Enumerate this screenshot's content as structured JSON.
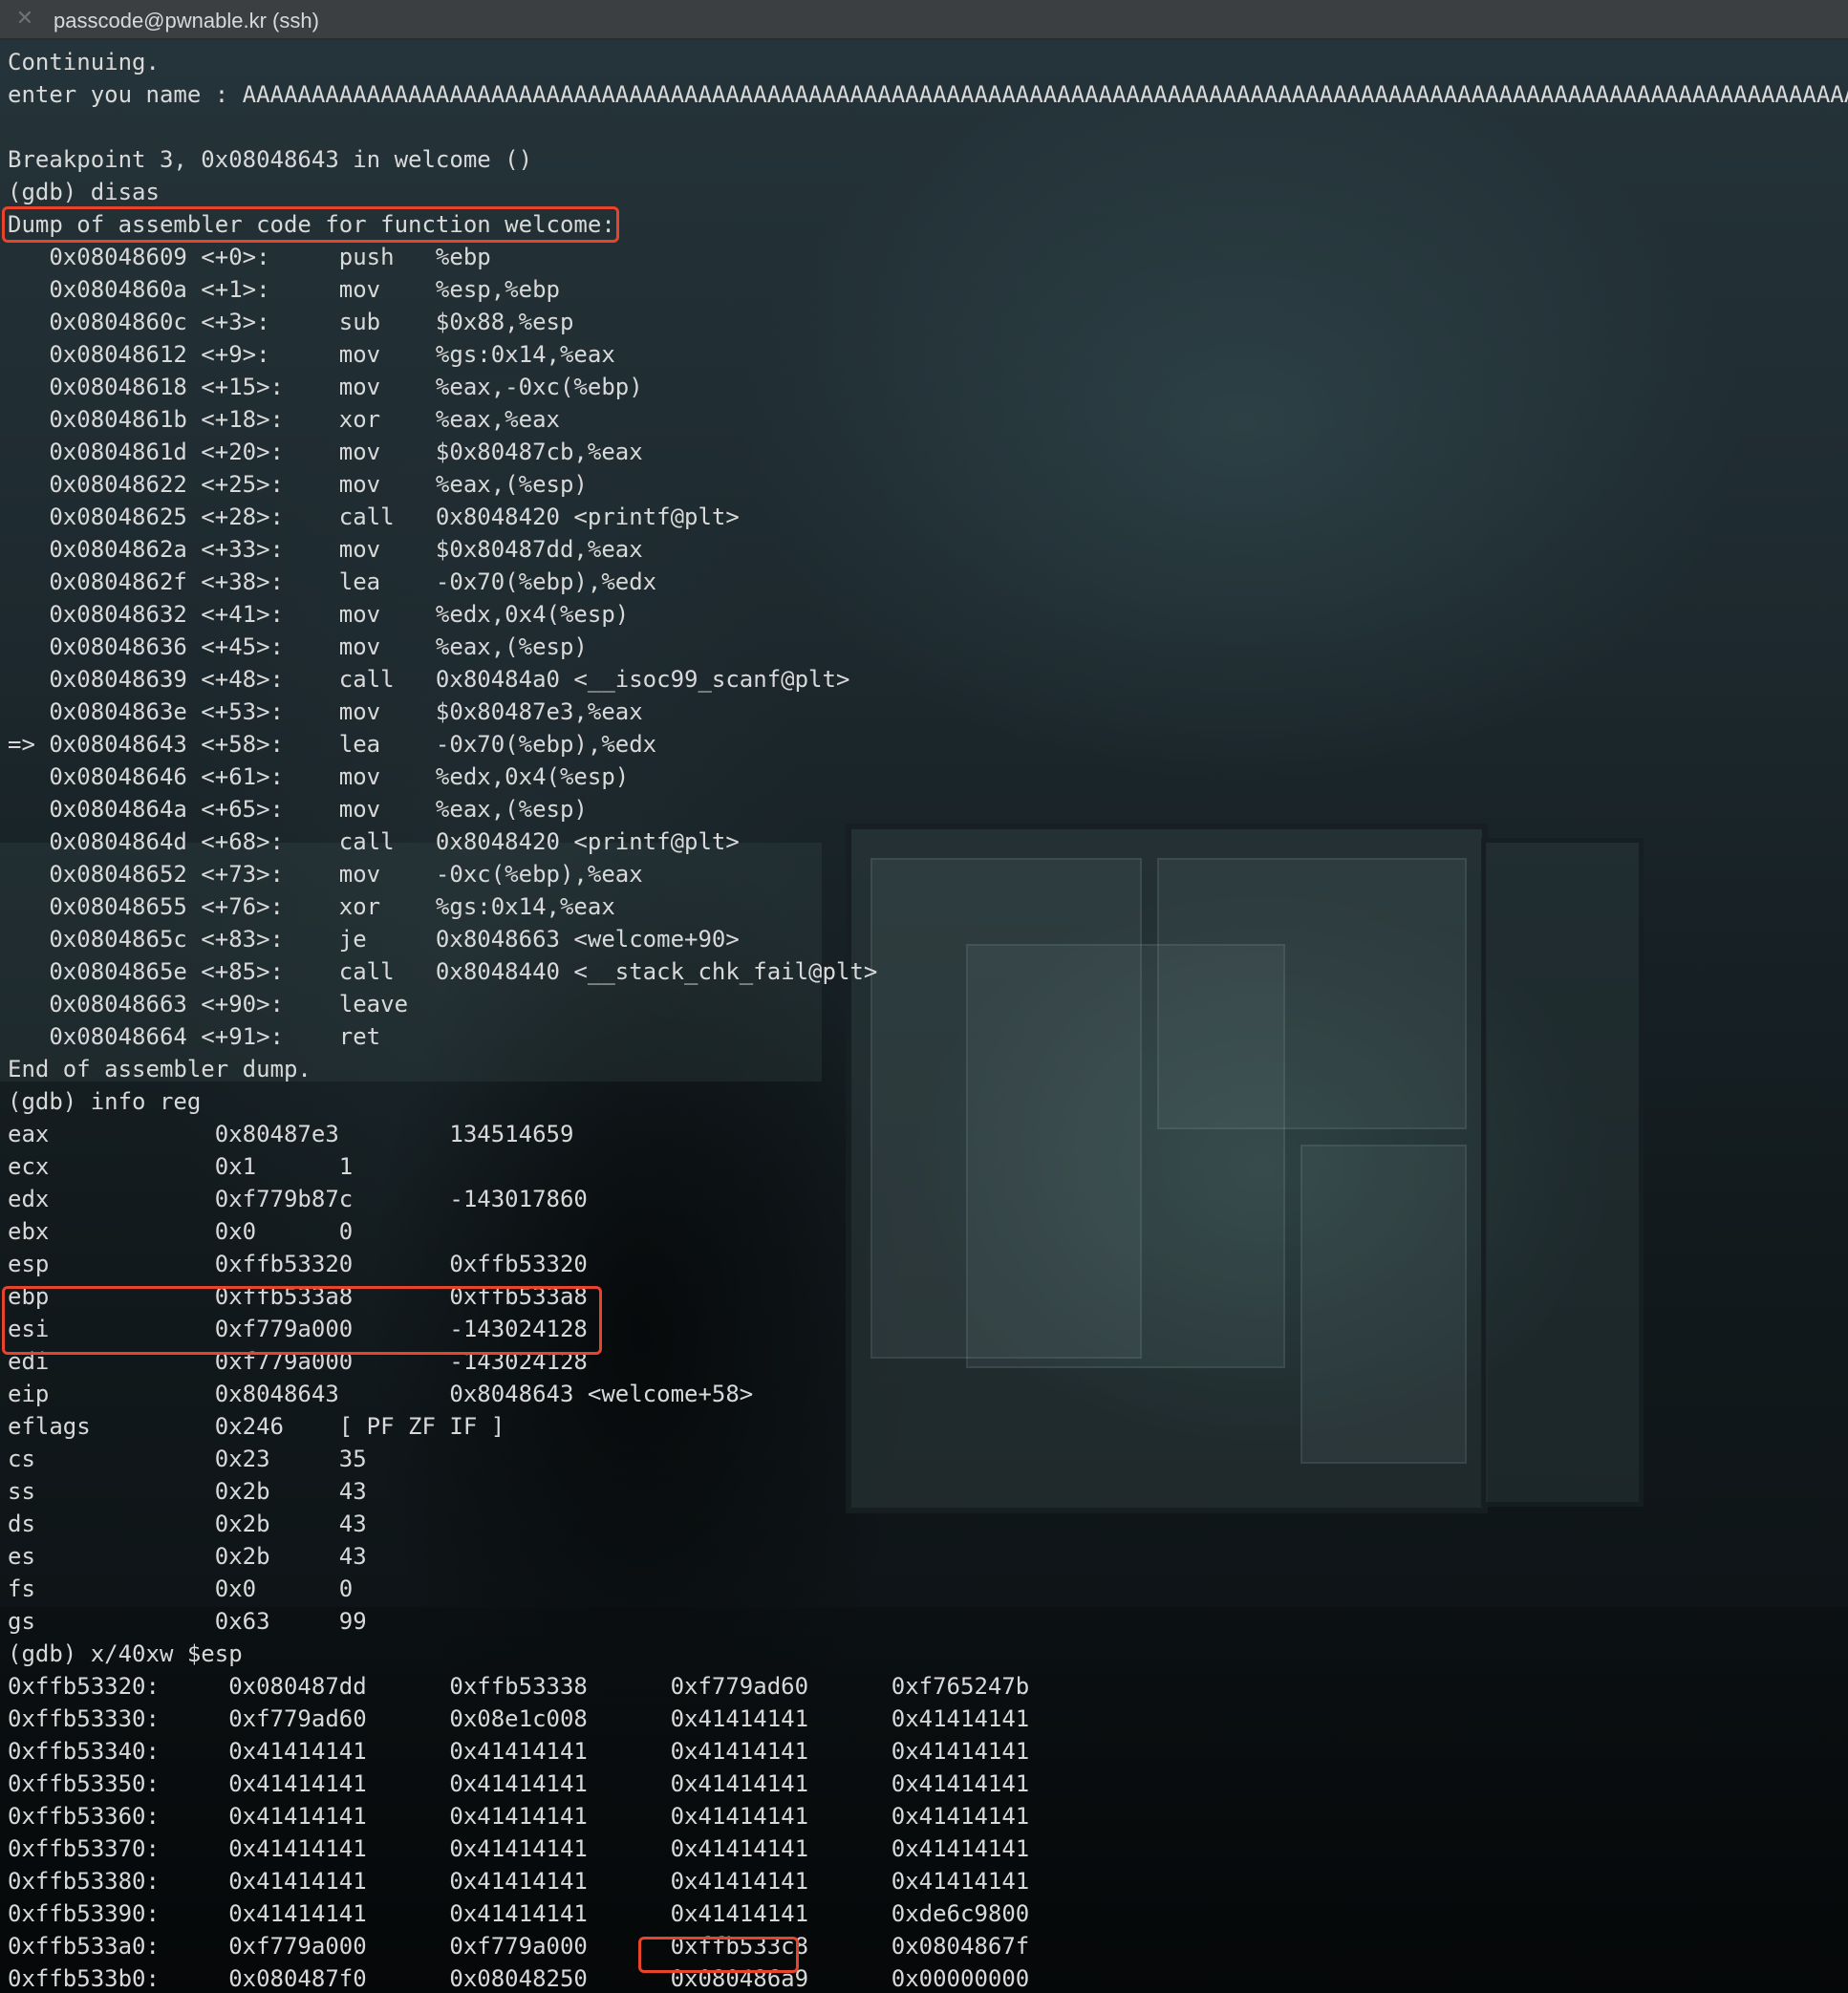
{
  "window": {
    "close_glyph": "✕",
    "title": "passcode@pwnable.kr (ssh)"
  },
  "terminal": {
    "lines": [
      "Continuing.",
      "enter you name : AAAAAAAAAAAAAAAAAAAAAAAAAAAAAAAAAAAAAAAAAAAAAAAAAAAAAAAAAAAAAAAAAAAAAAAAAAAAAAAAAAAAAAAAAAAAAAAAAAAAAAAAAAAAAAAAAAAAAAAA",
      "",
      "Breakpoint 3, 0x08048643 in welcome ()",
      "(gdb) disas",
      "Dump of assembler code for function welcome:",
      "   0x08048609 <+0>:     push   %ebp",
      "   0x0804860a <+1>:     mov    %esp,%ebp",
      "   0x0804860c <+3>:     sub    $0x88,%esp",
      "   0x08048612 <+9>:     mov    %gs:0x14,%eax",
      "   0x08048618 <+15>:    mov    %eax,-0xc(%ebp)",
      "   0x0804861b <+18>:    xor    %eax,%eax",
      "   0x0804861d <+20>:    mov    $0x80487cb,%eax",
      "   0x08048622 <+25>:    mov    %eax,(%esp)",
      "   0x08048625 <+28>:    call   0x8048420 <printf@plt>",
      "   0x0804862a <+33>:    mov    $0x80487dd,%eax",
      "   0x0804862f <+38>:    lea    -0x70(%ebp),%edx",
      "   0x08048632 <+41>:    mov    %edx,0x4(%esp)",
      "   0x08048636 <+45>:    mov    %eax,(%esp)",
      "   0x08048639 <+48>:    call   0x80484a0 <__isoc99_scanf@plt>",
      "   0x0804863e <+53>:    mov    $0x80487e3,%eax",
      "=> 0x08048643 <+58>:    lea    -0x70(%ebp),%edx",
      "   0x08048646 <+61>:    mov    %edx,0x4(%esp)",
      "   0x0804864a <+65>:    mov    %eax,(%esp)",
      "   0x0804864d <+68>:    call   0x8048420 <printf@plt>",
      "   0x08048652 <+73>:    mov    -0xc(%ebp),%eax",
      "   0x08048655 <+76>:    xor    %gs:0x14,%eax",
      "   0x0804865c <+83>:    je     0x8048663 <welcome+90>",
      "   0x0804865e <+85>:    call   0x8048440 <__stack_chk_fail@plt>",
      "   0x08048663 <+90>:    leave",
      "   0x08048664 <+91>:    ret",
      "End of assembler dump.",
      "(gdb) info reg",
      "eax            0x80487e3        134514659",
      "ecx            0x1      1",
      "edx            0xf779b87c       -143017860",
      "ebx            0x0      0",
      "esp            0xffb53320       0xffb53320",
      "ebp            0xffb533a8       0xffb533a8",
      "esi            0xf779a000       -143024128",
      "edi            0xf779a000       -143024128",
      "eip            0x8048643        0x8048643 <welcome+58>",
      "eflags         0x246    [ PF ZF IF ]",
      "cs             0x23     35",
      "ss             0x2b     43",
      "ds             0x2b     43",
      "es             0x2b     43",
      "fs             0x0      0",
      "gs             0x63     99",
      "(gdb) x/40xw $esp",
      "0xffb53320:     0x080487dd      0xffb53338      0xf779ad60      0xf765247b",
      "0xffb53330:     0xf779ad60      0x08e1c008      0x41414141      0x41414141",
      "0xffb53340:     0x41414141      0x41414141      0x41414141      0x41414141",
      "0xffb53350:     0x41414141      0x41414141      0x41414141      0x41414141",
      "0xffb53360:     0x41414141      0x41414141      0x41414141      0x41414141",
      "0xffb53370:     0x41414141      0x41414141      0x41414141      0x41414141",
      "0xffb53380:     0x41414141      0x41414141      0x41414141      0x41414141",
      "0xffb53390:     0x41414141      0x41414141      0x41414141      0xde6c9800",
      "0xffb533a0:     0xf779a000      0xf779a000      0xffb533c8      0x0804867f",
      "0xffb533b0:     0x080487f0      0x08048250      0x080486a9      0x00000000"
    ]
  },
  "highlight_color": "#e8432b"
}
